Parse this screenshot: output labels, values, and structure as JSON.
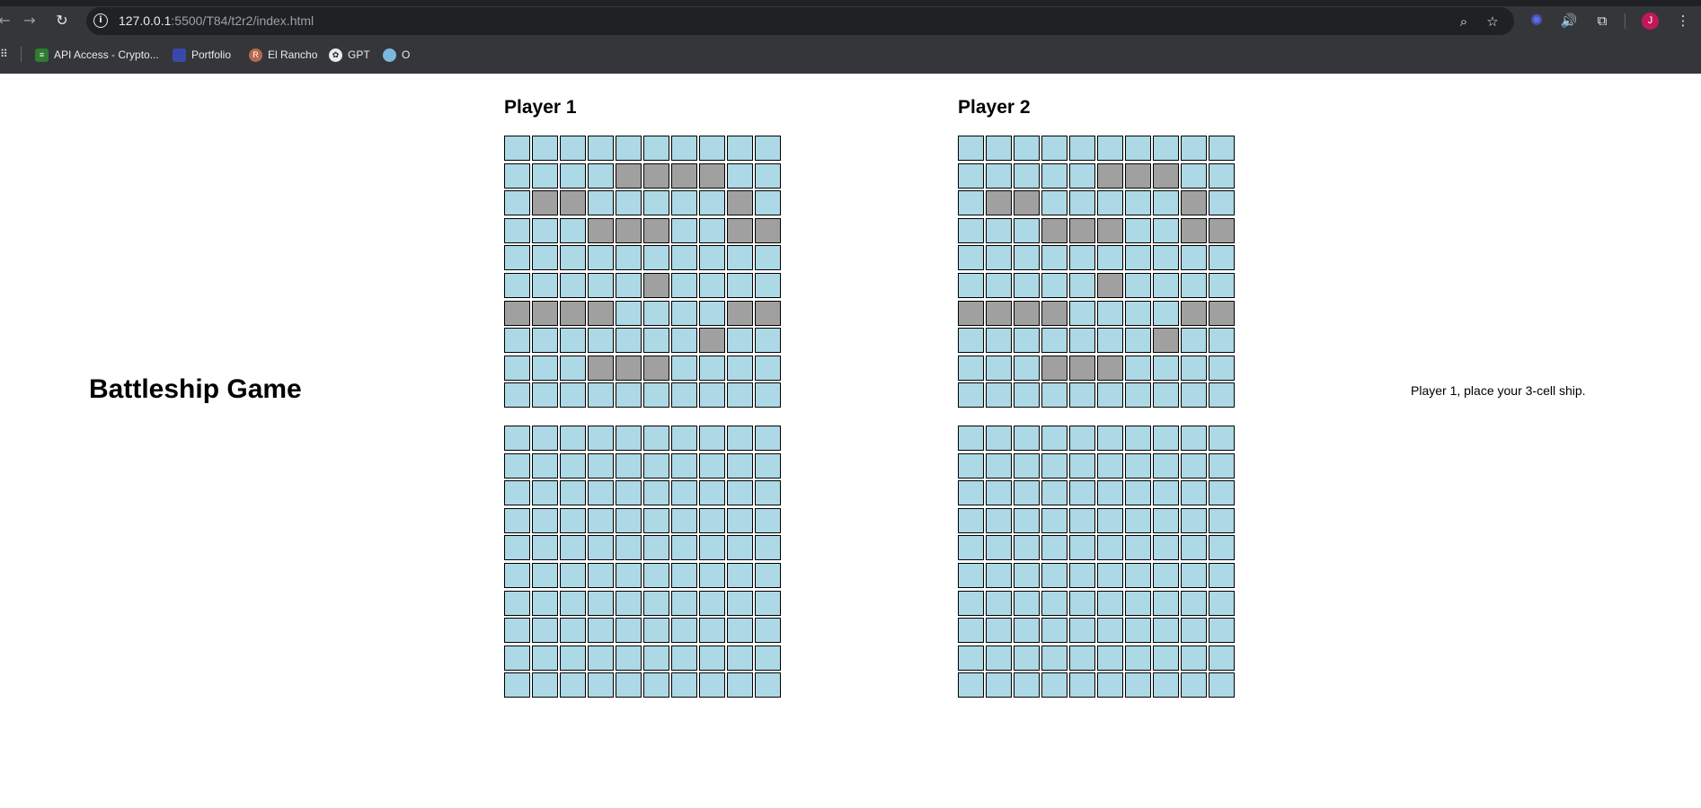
{
  "browser": {
    "url_host": "127.0.0.1",
    "url_path": ":5500/T84/t2r2/index.html",
    "profile_initial": "J",
    "bookmarks": [
      {
        "label": "API Access - Crypto...",
        "icon": "crypto-chart-icon"
      },
      {
        "label": "Portfolio",
        "icon": "portfolio-icon"
      },
      {
        "label": "El Rancho",
        "icon": "rancho-icon",
        "icon_letter": "R"
      },
      {
        "label": "GPT",
        "icon": "openai-icon"
      },
      {
        "label": "O",
        "icon": "o-icon"
      }
    ]
  },
  "game": {
    "title": "Battleship Game",
    "status": "Player 1, place your 3-cell ship.",
    "colors": {
      "water": "#add8e6",
      "ship": "#a0a0a0",
      "border": "#000000"
    },
    "players": [
      {
        "name": "Player 1",
        "placement_grid": [
          "0000000000",
          "0000111100",
          "0110000010",
          "0001110011",
          "0000000000",
          "0000010000",
          "1111000011",
          "0000000100",
          "0001110000",
          "0000000000"
        ],
        "target_grid": [
          "0000000000",
          "0000000000",
          "0000000000",
          "0000000000",
          "0000000000",
          "0000000000",
          "0000000000",
          "0000000000",
          "0000000000",
          "0000000000"
        ]
      },
      {
        "name": "Player 2",
        "placement_grid": [
          "0000000000",
          "0000011100",
          "0110000010",
          "0001110011",
          "0000000000",
          "0000010000",
          "1111000011",
          "0000000100",
          "0001110000",
          "0000000000"
        ],
        "target_grid": [
          "0000000000",
          "0000000000",
          "0000000000",
          "0000000000",
          "0000000000",
          "0000000000",
          "0000000000",
          "0000000000",
          "0000000000",
          "0000000000"
        ]
      }
    ]
  }
}
